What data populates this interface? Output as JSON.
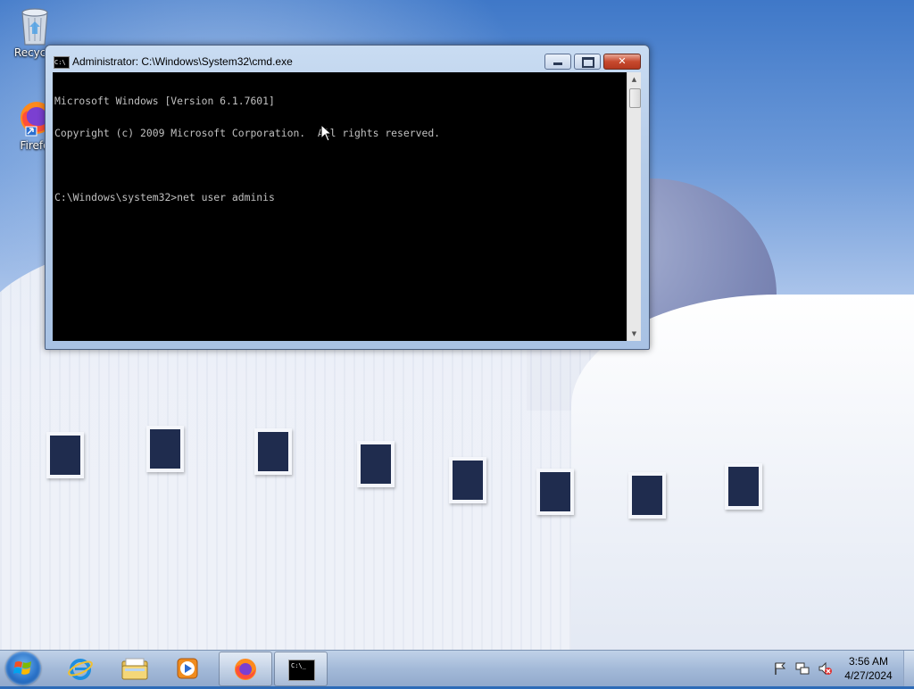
{
  "desktop": {
    "icons": [
      {
        "label": "Recycle"
      },
      {
        "label": "Firefo"
      }
    ]
  },
  "cmd": {
    "title": "Administrator: C:\\Windows\\System32\\cmd.exe",
    "title_icon_text": "C:\\",
    "lines": [
      "Microsoft Windows [Version 6.1.7601]",
      "Copyright (c) 2009 Microsoft Corporation.  All rights reserved.",
      "",
      "C:\\Windows\\system32>net user adminis"
    ],
    "buttons": {
      "minimize": "minimize-icon",
      "maximize": "maximize-icon",
      "close": "close-icon"
    }
  },
  "taskbar": {
    "pinned": [
      "internet-explorer-icon",
      "file-explorer-icon",
      "media-player-icon",
      "firefox-icon",
      "cmd-icon"
    ],
    "cmd_icon_text": "C:\\_",
    "clock": {
      "time": "3:56 AM",
      "date": "4/27/2024"
    }
  },
  "colors": {
    "console_bg": "#000000",
    "console_fg": "#c0c0c0",
    "close_button": "#c7492e"
  }
}
